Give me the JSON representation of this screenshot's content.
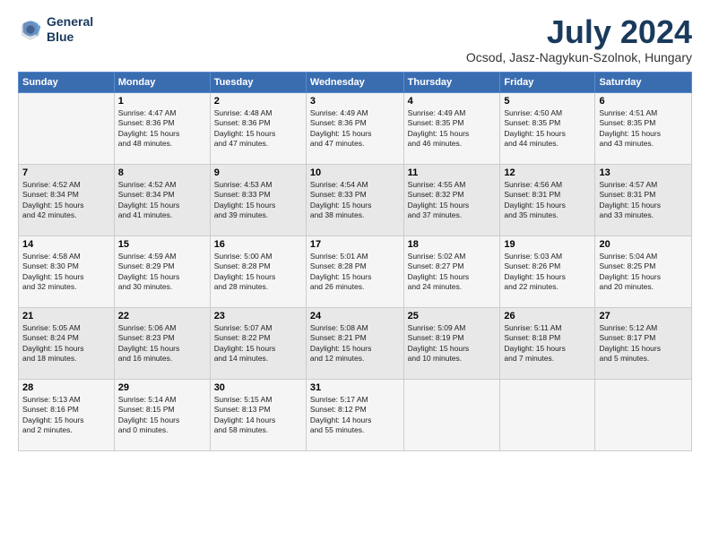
{
  "header": {
    "logo_line1": "General",
    "logo_line2": "Blue",
    "title": "July 2024",
    "location": "Ocsod, Jasz-Nagykun-Szolnok, Hungary"
  },
  "days_of_week": [
    "Sunday",
    "Monday",
    "Tuesday",
    "Wednesday",
    "Thursday",
    "Friday",
    "Saturday"
  ],
  "weeks": [
    [
      {
        "day": "",
        "info": ""
      },
      {
        "day": "1",
        "info": "Sunrise: 4:47 AM\nSunset: 8:36 PM\nDaylight: 15 hours\nand 48 minutes."
      },
      {
        "day": "2",
        "info": "Sunrise: 4:48 AM\nSunset: 8:36 PM\nDaylight: 15 hours\nand 47 minutes."
      },
      {
        "day": "3",
        "info": "Sunrise: 4:49 AM\nSunset: 8:36 PM\nDaylight: 15 hours\nand 47 minutes."
      },
      {
        "day": "4",
        "info": "Sunrise: 4:49 AM\nSunset: 8:35 PM\nDaylight: 15 hours\nand 46 minutes."
      },
      {
        "day": "5",
        "info": "Sunrise: 4:50 AM\nSunset: 8:35 PM\nDaylight: 15 hours\nand 44 minutes."
      },
      {
        "day": "6",
        "info": "Sunrise: 4:51 AM\nSunset: 8:35 PM\nDaylight: 15 hours\nand 43 minutes."
      }
    ],
    [
      {
        "day": "7",
        "info": "Sunrise: 4:52 AM\nSunset: 8:34 PM\nDaylight: 15 hours\nand 42 minutes."
      },
      {
        "day": "8",
        "info": "Sunrise: 4:52 AM\nSunset: 8:34 PM\nDaylight: 15 hours\nand 41 minutes."
      },
      {
        "day": "9",
        "info": "Sunrise: 4:53 AM\nSunset: 8:33 PM\nDaylight: 15 hours\nand 39 minutes."
      },
      {
        "day": "10",
        "info": "Sunrise: 4:54 AM\nSunset: 8:33 PM\nDaylight: 15 hours\nand 38 minutes."
      },
      {
        "day": "11",
        "info": "Sunrise: 4:55 AM\nSunset: 8:32 PM\nDaylight: 15 hours\nand 37 minutes."
      },
      {
        "day": "12",
        "info": "Sunrise: 4:56 AM\nSunset: 8:31 PM\nDaylight: 15 hours\nand 35 minutes."
      },
      {
        "day": "13",
        "info": "Sunrise: 4:57 AM\nSunset: 8:31 PM\nDaylight: 15 hours\nand 33 minutes."
      }
    ],
    [
      {
        "day": "14",
        "info": "Sunrise: 4:58 AM\nSunset: 8:30 PM\nDaylight: 15 hours\nand 32 minutes."
      },
      {
        "day": "15",
        "info": "Sunrise: 4:59 AM\nSunset: 8:29 PM\nDaylight: 15 hours\nand 30 minutes."
      },
      {
        "day": "16",
        "info": "Sunrise: 5:00 AM\nSunset: 8:28 PM\nDaylight: 15 hours\nand 28 minutes."
      },
      {
        "day": "17",
        "info": "Sunrise: 5:01 AM\nSunset: 8:28 PM\nDaylight: 15 hours\nand 26 minutes."
      },
      {
        "day": "18",
        "info": "Sunrise: 5:02 AM\nSunset: 8:27 PM\nDaylight: 15 hours\nand 24 minutes."
      },
      {
        "day": "19",
        "info": "Sunrise: 5:03 AM\nSunset: 8:26 PM\nDaylight: 15 hours\nand 22 minutes."
      },
      {
        "day": "20",
        "info": "Sunrise: 5:04 AM\nSunset: 8:25 PM\nDaylight: 15 hours\nand 20 minutes."
      }
    ],
    [
      {
        "day": "21",
        "info": "Sunrise: 5:05 AM\nSunset: 8:24 PM\nDaylight: 15 hours\nand 18 minutes."
      },
      {
        "day": "22",
        "info": "Sunrise: 5:06 AM\nSunset: 8:23 PM\nDaylight: 15 hours\nand 16 minutes."
      },
      {
        "day": "23",
        "info": "Sunrise: 5:07 AM\nSunset: 8:22 PM\nDaylight: 15 hours\nand 14 minutes."
      },
      {
        "day": "24",
        "info": "Sunrise: 5:08 AM\nSunset: 8:21 PM\nDaylight: 15 hours\nand 12 minutes."
      },
      {
        "day": "25",
        "info": "Sunrise: 5:09 AM\nSunset: 8:19 PM\nDaylight: 15 hours\nand 10 minutes."
      },
      {
        "day": "26",
        "info": "Sunrise: 5:11 AM\nSunset: 8:18 PM\nDaylight: 15 hours\nand 7 minutes."
      },
      {
        "day": "27",
        "info": "Sunrise: 5:12 AM\nSunset: 8:17 PM\nDaylight: 15 hours\nand 5 minutes."
      }
    ],
    [
      {
        "day": "28",
        "info": "Sunrise: 5:13 AM\nSunset: 8:16 PM\nDaylight: 15 hours\nand 2 minutes."
      },
      {
        "day": "29",
        "info": "Sunrise: 5:14 AM\nSunset: 8:15 PM\nDaylight: 15 hours\nand 0 minutes."
      },
      {
        "day": "30",
        "info": "Sunrise: 5:15 AM\nSunset: 8:13 PM\nDaylight: 14 hours\nand 58 minutes."
      },
      {
        "day": "31",
        "info": "Sunrise: 5:17 AM\nSunset: 8:12 PM\nDaylight: 14 hours\nand 55 minutes."
      },
      {
        "day": "",
        "info": ""
      },
      {
        "day": "",
        "info": ""
      },
      {
        "day": "",
        "info": ""
      }
    ]
  ]
}
